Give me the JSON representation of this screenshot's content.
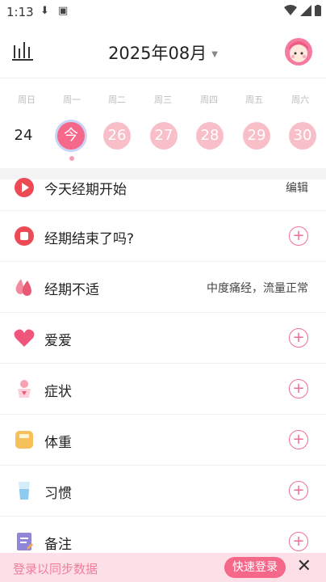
{
  "status": {
    "time": "1:13"
  },
  "header": {
    "month": "2025年08月"
  },
  "week": {
    "labels": [
      "周日",
      "周一",
      "周二",
      "周三",
      "周四",
      "周五",
      "周六"
    ],
    "days": [
      "24",
      "今",
      "26",
      "27",
      "28",
      "29",
      "30"
    ]
  },
  "list": {
    "items": [
      {
        "label": "今天经期开始",
        "right": "编辑"
      },
      {
        "label": "经期结束了吗?",
        "right": "+"
      },
      {
        "label": "经期不适",
        "right": "中度痛经，流量正常"
      },
      {
        "label": "爱爱",
        "right": "+"
      },
      {
        "label": "症状",
        "right": "+"
      },
      {
        "label": "体重",
        "right": "+"
      },
      {
        "label": "习惯",
        "right": "+"
      },
      {
        "label": "备注",
        "right": "+"
      }
    ]
  },
  "bottom": {
    "message": "登录以同步数据",
    "login": "快速登录",
    "close": "✕"
  },
  "colors": {
    "accent": "#f5688a",
    "period_light": "#f9bfc9",
    "bottom_bg": "#fde0e7"
  }
}
